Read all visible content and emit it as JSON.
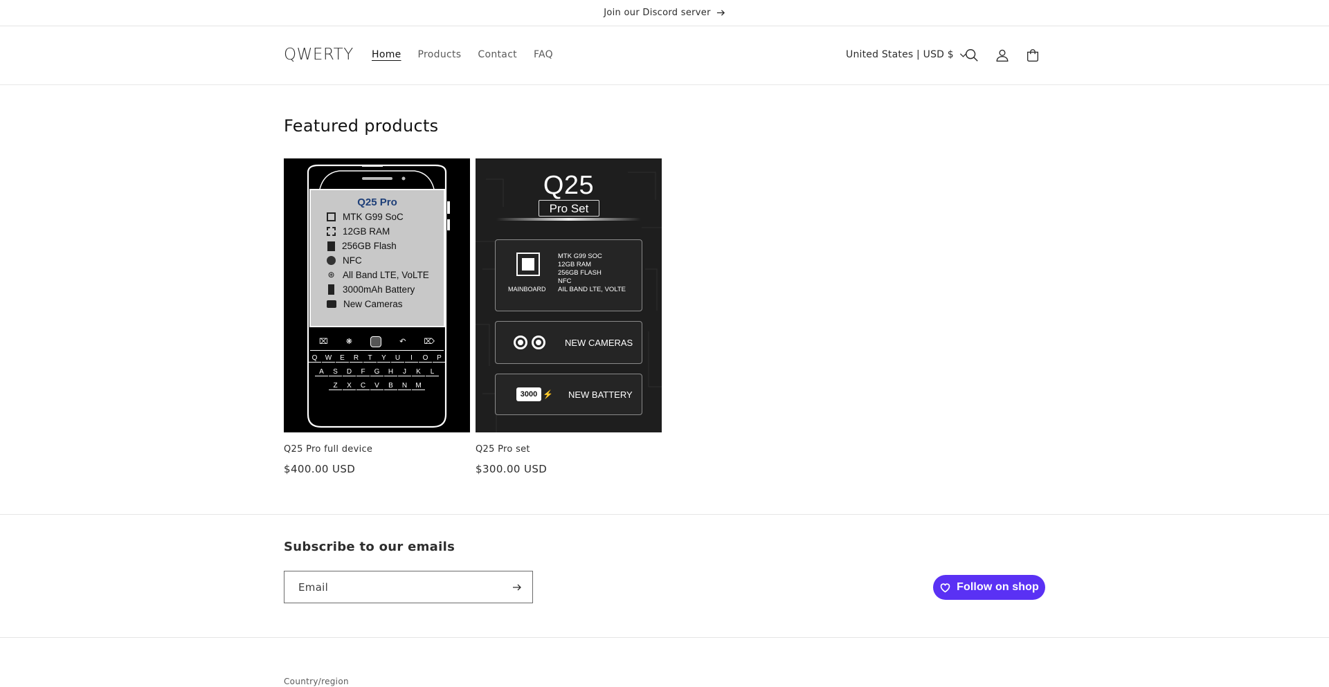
{
  "announcement": {
    "text": "Join our Discord server"
  },
  "header": {
    "logo": "QWERTY",
    "nav": [
      {
        "label": "Home"
      },
      {
        "label": "Products"
      },
      {
        "label": "Contact"
      },
      {
        "label": "FAQ"
      }
    ],
    "locale": "United States | USD $",
    "icons": [
      "search-icon",
      "account-icon",
      "cart-icon"
    ]
  },
  "featured": {
    "title": "Featured products",
    "products": [
      {
        "title": "Q25 Pro full device",
        "price": "$400.00 USD",
        "image": {
          "heading": "Q25 Pro",
          "specs": [
            "MTK G99 SoC",
            "12GB RAM",
            "256GB Flash",
            "NFC",
            "All Band LTE, VoLTE",
            "3000mAh Battery",
            "New Cameras"
          ],
          "keys_row1": [
            "Q",
            "W",
            "E",
            "R",
            "T",
            "Y",
            "U",
            "I",
            "O",
            "P"
          ],
          "keys_row2": [
            "A",
            "S",
            "D",
            "F",
            "G",
            "H",
            "J",
            "K",
            "L"
          ],
          "keys_row3": [
            "Z",
            "X",
            "C",
            "V",
            "B",
            "N",
            "M"
          ]
        }
      },
      {
        "title": "Q25 Pro set",
        "price": "$300.00 USD",
        "image": {
          "heading": "Q25",
          "subheading": "Pro Set",
          "mainboard_label": "MAINBOARD",
          "mainboard_specs": [
            "MTK G99 SOC",
            "12GB RAM",
            "256GB FLASH",
            "NFC",
            "AIL BAND LTE, VOLTE"
          ],
          "cameras_label": "NEW CAMERAS",
          "battery_value": "3000",
          "battery_label": "NEW BATTERY"
        }
      }
    ]
  },
  "subscribe": {
    "title": "Subscribe to our emails",
    "email_placeholder": "Email"
  },
  "follow": {
    "label": "Follow on shop",
    "color": "#5a31f4"
  },
  "footer": {
    "country_label": "Country/region"
  }
}
